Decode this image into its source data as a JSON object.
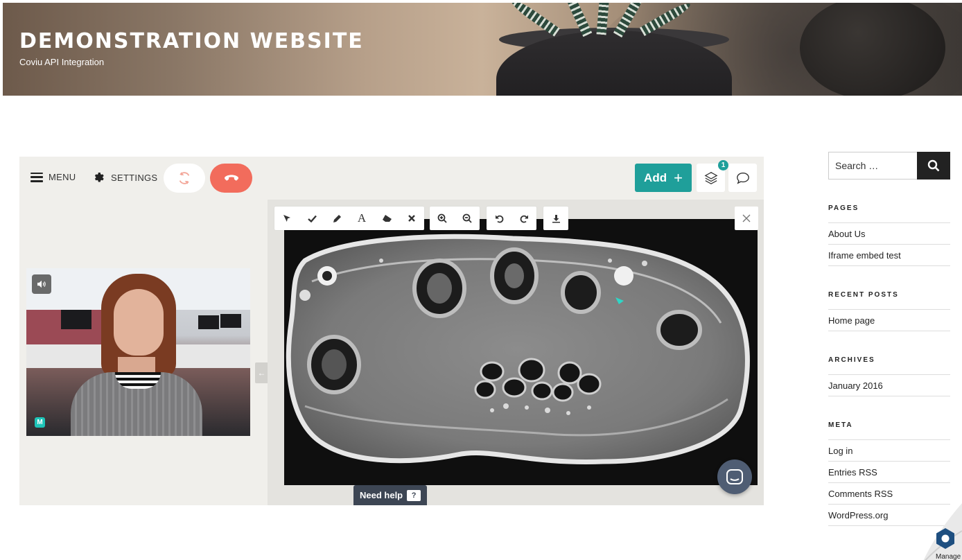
{
  "site": {
    "title": "DEMONSTRATION WEBSITE",
    "tagline": "Coviu API Integration"
  },
  "toolbar": {
    "menu_label": "MENU",
    "settings_label": "SETTINGS",
    "add_label": "Add",
    "layers_badge": "1"
  },
  "video": {
    "participant_initial": "M"
  },
  "viewer": {
    "tools": [
      "pointer-icon",
      "check-icon",
      "pencil-icon",
      "text-icon",
      "eraser-icon",
      "clear-icon",
      "zoom-in-icon",
      "zoom-out-icon",
      "rotate-left-icon",
      "rotate-right-icon",
      "download-icon"
    ],
    "text_tool_label": "A",
    "help_label": "Need help",
    "help_icon_label": "?"
  },
  "sidebar": {
    "search_placeholder": "Search …",
    "pages": {
      "title": "PAGES",
      "items": [
        "About Us",
        "Iframe embed test"
      ]
    },
    "recent_posts": {
      "title": "RECENT POSTS",
      "items": [
        "Home page"
      ]
    },
    "archives": {
      "title": "ARCHIVES",
      "items": [
        "January 2016"
      ]
    },
    "meta": {
      "title": "META",
      "items": [
        "Log in",
        "Entries RSS",
        "Comments RSS",
        "WordPress.org"
      ]
    }
  },
  "corner_badge": {
    "label": "Manage"
  },
  "colors": {
    "accent_teal": "#1f9f9a",
    "hangup_red": "#f26c5c",
    "help_dark": "#3d4654"
  }
}
